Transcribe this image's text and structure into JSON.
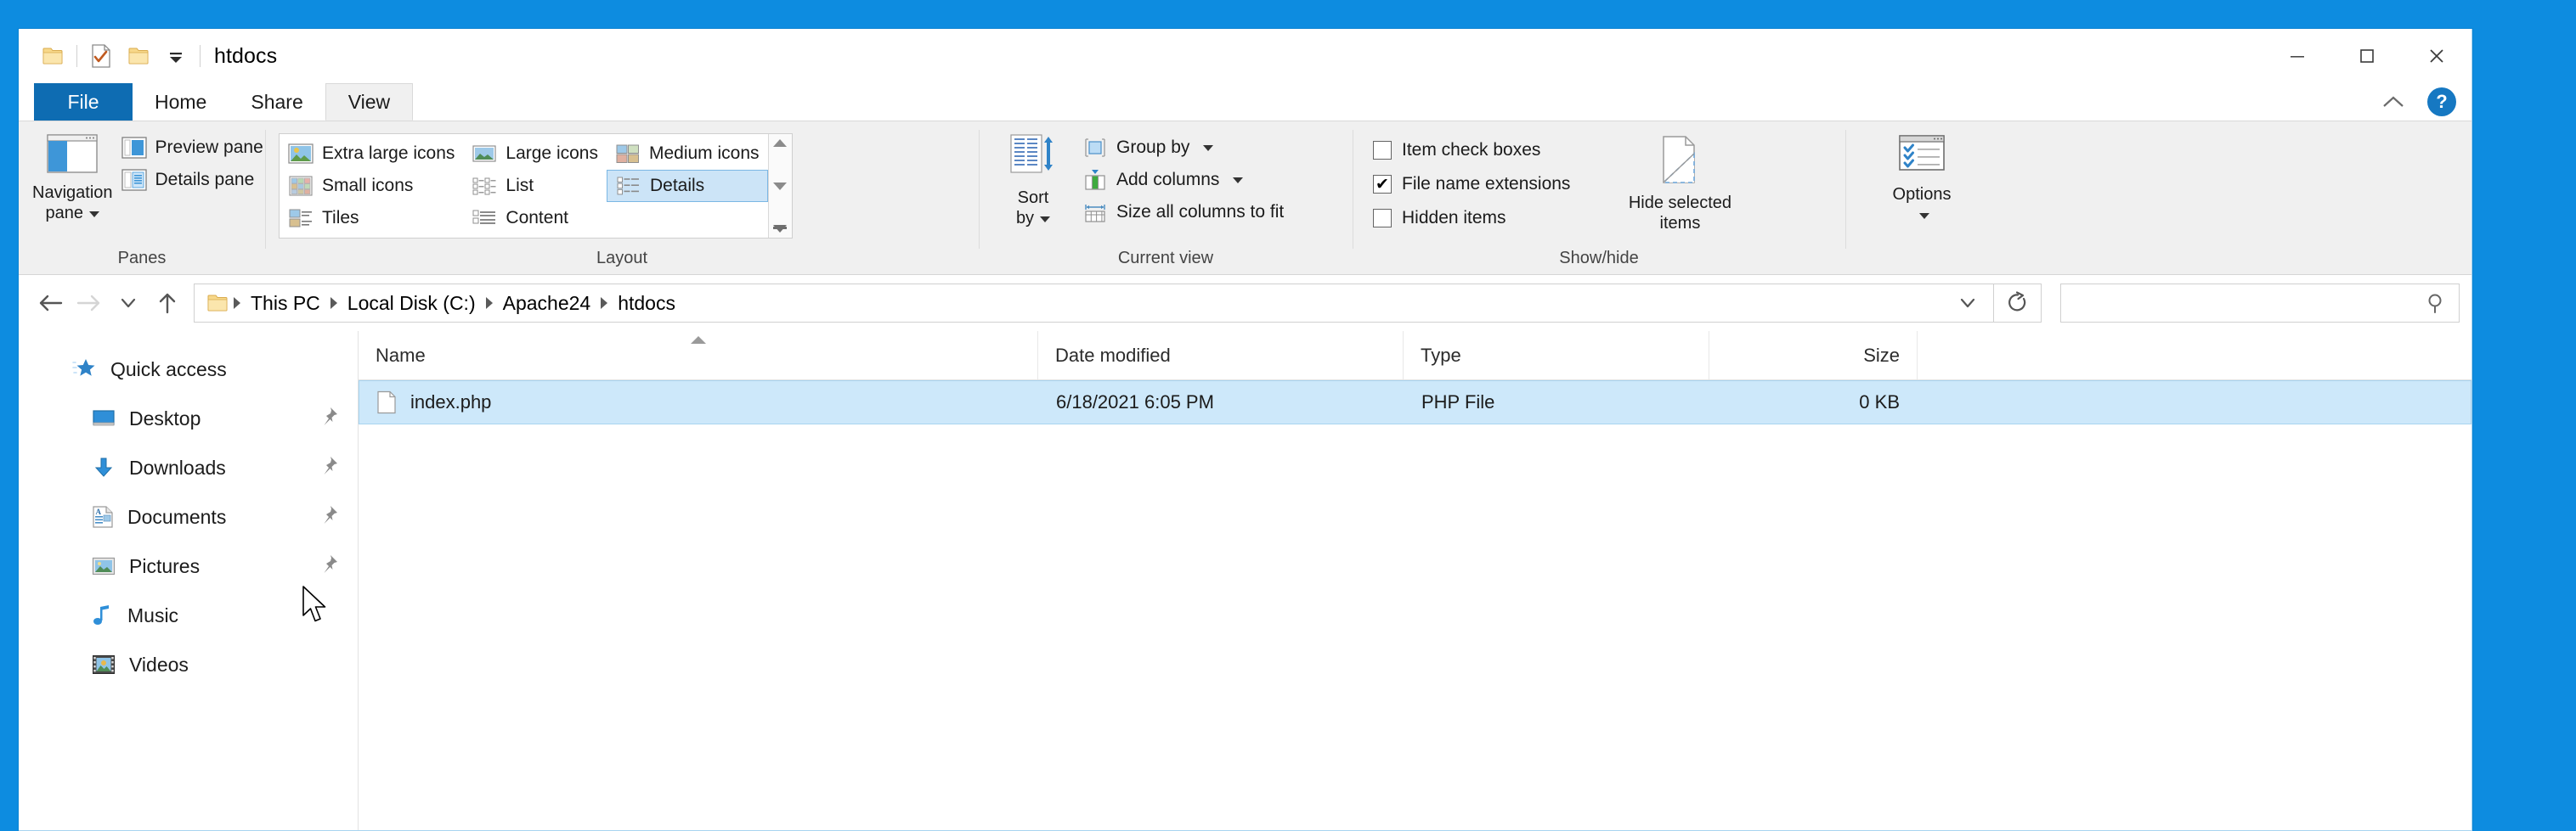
{
  "window": {
    "title": "htdocs",
    "quick_access_toolbar": [
      {
        "name": "folder-icon",
        "label": "Folder"
      },
      {
        "name": "properties-icon",
        "label": "Properties"
      },
      {
        "name": "new-folder-icon",
        "label": "New folder"
      },
      {
        "name": "customize-dropdown-icon",
        "label": "Customize Quick Access Toolbar"
      }
    ],
    "controls": {
      "minimize": "Minimize",
      "maximize": "Maximize",
      "close": "Close"
    }
  },
  "ribbon": {
    "tabs": [
      {
        "label": "File",
        "active": false,
        "style": "file"
      },
      {
        "label": "Home",
        "active": false
      },
      {
        "label": "Share",
        "active": false
      },
      {
        "label": "View",
        "active": true
      }
    ],
    "collapse_label": "Minimize the Ribbon",
    "help_label": "?",
    "groups": {
      "panes": {
        "title": "Panes",
        "navigation_pane": "Navigation\npane",
        "navigation_pane_line1": "Navigation",
        "navigation_pane_line2": "pane",
        "preview_pane": "Preview pane",
        "details_pane": "Details pane"
      },
      "layout": {
        "title": "Layout",
        "items": [
          {
            "label": "Extra large icons",
            "selected": false
          },
          {
            "label": "Large icons",
            "selected": false
          },
          {
            "label": "Medium icons",
            "selected": false
          },
          {
            "label": "Small icons",
            "selected": false
          },
          {
            "label": "List",
            "selected": false
          },
          {
            "label": "Details",
            "selected": true
          },
          {
            "label": "Tiles",
            "selected": false
          },
          {
            "label": "Content",
            "selected": false
          }
        ]
      },
      "current_view": {
        "title": "Current view",
        "sort_by_line1": "Sort",
        "sort_by_line2": "by",
        "group_by": "Group by",
        "add_columns": "Add columns",
        "size_all_columns": "Size all columns to fit"
      },
      "show_hide": {
        "title": "Show/hide",
        "checkboxes": [
          {
            "label": "Item check boxes",
            "checked": false
          },
          {
            "label": "File name extensions",
            "checked": true
          },
          {
            "label": "Hidden items",
            "checked": false
          }
        ],
        "hide_selected_line1": "Hide selected",
        "hide_selected_line2": "items"
      },
      "options": {
        "label": "Options"
      }
    }
  },
  "address_bar": {
    "back_label": "Back",
    "forward_label": "Forward",
    "recent_label": "Recent locations",
    "up_label": "Up",
    "breadcrumbs": [
      "This PC",
      "Local Disk (C:)",
      "Apache24",
      "htdocs"
    ],
    "refresh_label": "Refresh",
    "dropdown_label": "Previous locations",
    "search": {
      "value": "",
      "placeholder": ""
    }
  },
  "sidebar": {
    "items": [
      {
        "label": "Quick access",
        "icon": "star-icon",
        "level": "root",
        "pinned": false
      },
      {
        "label": "Desktop",
        "icon": "desktop-icon",
        "level": "child",
        "pinned": true
      },
      {
        "label": "Downloads",
        "icon": "downloads-icon",
        "level": "child",
        "pinned": true
      },
      {
        "label": "Documents",
        "icon": "documents-icon",
        "level": "child",
        "pinned": true
      },
      {
        "label": "Pictures",
        "icon": "pictures-icon",
        "level": "child",
        "pinned": true
      },
      {
        "label": "Music",
        "icon": "music-icon",
        "level": "child",
        "pinned": false
      },
      {
        "label": "Videos",
        "icon": "videos-icon",
        "level": "child",
        "pinned": false
      }
    ]
  },
  "file_list": {
    "columns": [
      {
        "label": "Name",
        "sorted": "asc"
      },
      {
        "label": "Date modified",
        "sorted": null
      },
      {
        "label": "Type",
        "sorted": null
      },
      {
        "label": "Size",
        "sorted": null
      }
    ],
    "rows": [
      {
        "name": "index.php",
        "date_modified": "6/18/2021 6:05 PM",
        "type": "PHP File",
        "size": "0 KB",
        "selected": true,
        "icon": "file-icon"
      }
    ]
  },
  "colors": {
    "accent": "#0d8ce0",
    "file_tab": "#0e6cb2",
    "selection": "#cde8fa",
    "ribbon_selection": "#cce4f7",
    "ribbon_bg": "#f0f0f0",
    "folder_yellow": "#f7d88a"
  }
}
